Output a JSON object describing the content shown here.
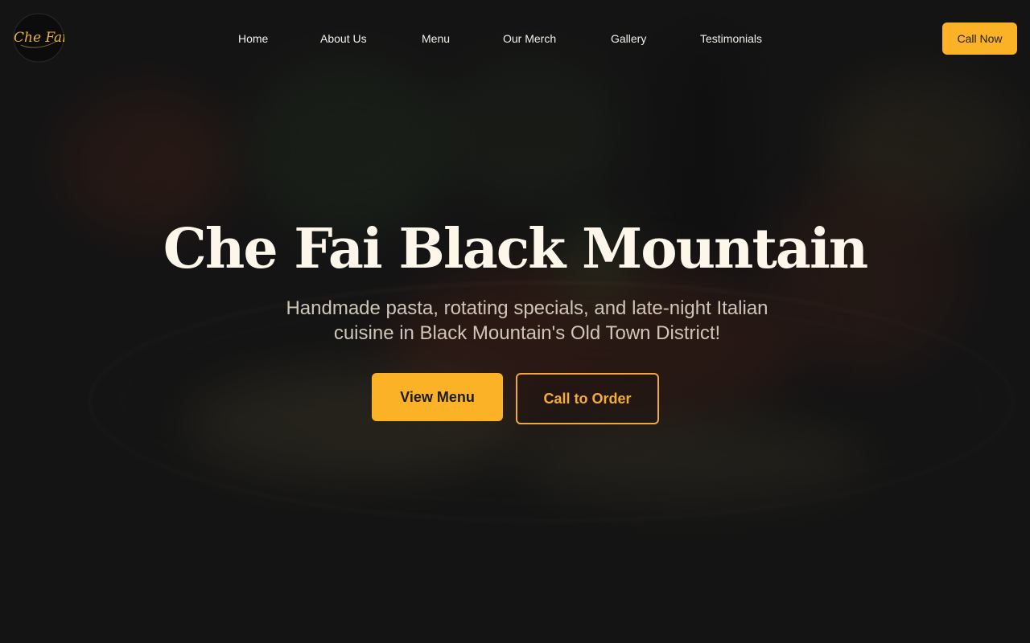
{
  "brand": {
    "logo_text": "Che Fai",
    "logo_icon": "script-wordmark-circle",
    "accent_color": "#fbb227"
  },
  "nav": {
    "items": [
      {
        "label": "Home"
      },
      {
        "label": "About Us"
      },
      {
        "label": "Menu"
      },
      {
        "label": "Our Merch"
      },
      {
        "label": "Gallery"
      },
      {
        "label": "Testimonials"
      }
    ],
    "cta_label": "Call Now"
  },
  "hero": {
    "title": "Che Fai Black Mountain",
    "subtitle": "Handmade pasta, rotating specials, and late-night Italian cuisine in Black Mountain's Old Town District!",
    "primary_button": "View Menu",
    "secondary_button": "Call to Order",
    "background_image": "blurred-pasta-plate"
  }
}
